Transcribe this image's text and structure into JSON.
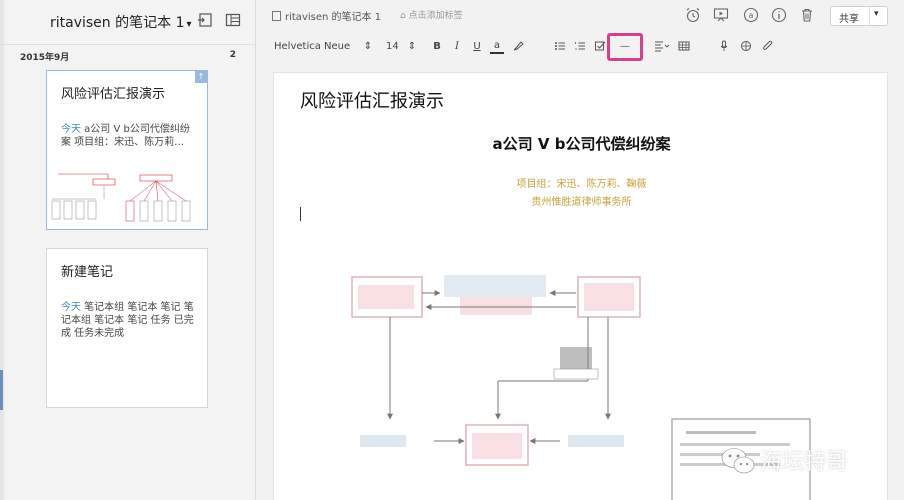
{
  "sidebar": {
    "notebook_title": "ritavisen 的笔记本 1",
    "month_label": "2015年9月",
    "month_count": "2",
    "notes": [
      {
        "title": "风险评估汇报演示",
        "today": "今天",
        "snippet": " a公司 V b公司代偿纠纷案 项目组：宋迅、陈万莉…"
      },
      {
        "title": "新建笔记",
        "today": "今天",
        "snippet": " 笔记本组 笔记本 笔记 笔记本组 笔记本 笔记 任务 已完成 任务未完成"
      }
    ]
  },
  "toolbar": {
    "breadcrumb": "ritavisen 的笔记本 1",
    "tag_placeholder": "点击添加标签",
    "share_label": "共享"
  },
  "format_bar": {
    "font_family": "Helvetica Neue",
    "font_size": "14",
    "bold": "B",
    "italic": "I",
    "underline": "U",
    "font_color": "a",
    "horizontal_rule": "—"
  },
  "editor": {
    "note_title": "风险评估汇报演示",
    "doc_heading": "a公司 V b公司代偿纠纷案",
    "team_line": "项目组：宋迅、陈万莉、鞠薇",
    "firm_line": "贵州惟胜道律师事务所"
  },
  "watermark": {
    "text": "海坛特哥"
  },
  "colors": {
    "accent": "#3f86c8",
    "highlight": "#d93e8c",
    "gold": "#c9a13a"
  }
}
